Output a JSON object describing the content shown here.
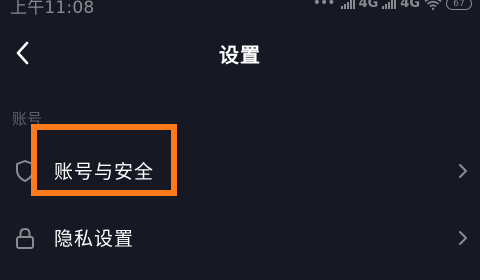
{
  "status_bar": {
    "time": "上午11:08",
    "dots": "•••",
    "network_1": "4G",
    "network_2": "4G",
    "battery": "67"
  },
  "nav": {
    "title": "设置",
    "back_icon": "chevron-left-icon"
  },
  "section": {
    "header": "账号"
  },
  "items": [
    {
      "label": "账号与安全",
      "icon": "shield-icon"
    },
    {
      "label": "隐私设置",
      "icon": "lock-icon"
    }
  ],
  "colors": {
    "background": "#161823",
    "highlight": "#ff7a1a",
    "muted_text": "#5f6068"
  }
}
